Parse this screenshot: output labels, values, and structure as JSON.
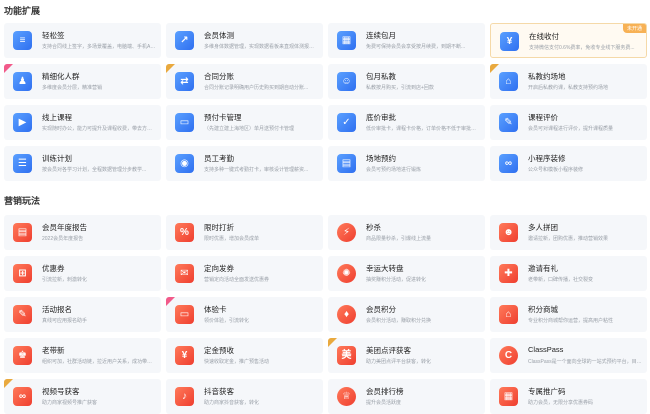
{
  "sections": {
    "features_title": "功能扩展",
    "marketing_title": "营销玩法"
  },
  "features": [
    {
      "title": "轻松签",
      "desc": "支持合同线上签字，多场景覆盖，电脑端、手机APP...",
      "icon": "contract-icon",
      "glyph": "≡",
      "color": "blue"
    },
    {
      "title": "会员体测",
      "desc": "多维身体数据管理，实现数据看板来直观体测报告...",
      "icon": "chart-line-icon",
      "glyph": "↗",
      "color": "blue"
    },
    {
      "title": "连续包月",
      "desc": "免费可保持会员会享受按月续费，到期不断...",
      "icon": "calendar-icon",
      "glyph": "▦",
      "color": "blue"
    },
    {
      "title": "在线收付",
      "desc": "支持微信支付0.6%费率，免收专业线下服务费...",
      "icon": "payment-icon",
      "glyph": "¥",
      "color": "blue",
      "badge": "未开通"
    },
    {
      "title": "精细化人群",
      "desc": "多维度会员分层，精准营销",
      "icon": "user-group-icon",
      "glyph": "♟",
      "color": "blue",
      "corner": "pink"
    },
    {
      "title": "合同分账",
      "desc": "合同分账记录明确用户历史购买到期自动分账...",
      "icon": "split-icon",
      "glyph": "⇄",
      "color": "blue",
      "corner": "gold"
    },
    {
      "title": "包月私教",
      "desc": "私教按月购买，引流到店+回款",
      "icon": "coach-icon",
      "glyph": "☺",
      "color": "blue"
    },
    {
      "title": "私教约场地",
      "desc": "开启后私教约课，私教支持预约场地",
      "icon": "venue-icon",
      "glyph": "⌂",
      "color": "blue",
      "corner": "gold"
    },
    {
      "title": "线上课程",
      "desc": "实现随时办公，能力可提升及课程收费，带去方便工...",
      "icon": "video-icon",
      "glyph": "▶",
      "color": "blue"
    },
    {
      "title": "预付卡管理",
      "desc": "（先建立建上海地区）单月送预付卡管理",
      "icon": "card-icon",
      "glyph": "▭",
      "color": "blue"
    },
    {
      "title": "底价审批",
      "desc": "低价审批卡，课程卡价格，订单价格不低于审批设计...",
      "icon": "approval-icon",
      "glyph": "✓",
      "color": "blue"
    },
    {
      "title": "课程评价",
      "desc": "会员可对课程进行评价，提升课程质量",
      "icon": "comment-icon",
      "glyph": "✎",
      "color": "blue"
    },
    {
      "title": "训练计划",
      "desc": "按会员对各学习计划，全程数据管理分步教学...",
      "icon": "plan-icon",
      "glyph": "☰",
      "color": "blue"
    },
    {
      "title": "员工考勤",
      "desc": "支持多种一键式考勤打卡，审核设计管理薪资...",
      "icon": "location-icon",
      "glyph": "◉",
      "color": "blue"
    },
    {
      "title": "场地预约",
      "desc": "会员可预约场地进行锻炼",
      "icon": "ticket-icon",
      "glyph": "▤",
      "color": "blue"
    },
    {
      "title": "小程序装修",
      "desc": "公众号和模板小程序装修",
      "icon": "miniapp-icon",
      "glyph": "∞",
      "color": "blue"
    }
  ],
  "marketing": [
    {
      "title": "会员年度报告",
      "desc": "2022会员年度报告",
      "icon": "report-icon",
      "glyph": "▤",
      "shape": "sq"
    },
    {
      "title": "限时打折",
      "desc": "限时优惠，增加会员成单",
      "icon": "discount-icon",
      "glyph": "%",
      "shape": "sq"
    },
    {
      "title": "秒杀",
      "desc": "商品限量秒杀，引爆线上流量",
      "icon": "flash-sale-icon",
      "glyph": "⚡",
      "shape": "circle"
    },
    {
      "title": "多人拼团",
      "desc": "邀请拉新，团购优惠，推动营销效果",
      "icon": "group-buy-icon",
      "glyph": "☻",
      "shape": "sq"
    },
    {
      "title": "优惠券",
      "desc": "引流拉新，刺激转化",
      "icon": "coupon-icon",
      "glyph": "⊞",
      "shape": "sq"
    },
    {
      "title": "定向发券",
      "desc": "营销定向活动全面发送优惠券",
      "icon": "targeted-coupon-icon",
      "glyph": "✉",
      "shape": "sq"
    },
    {
      "title": "幸运大转盘",
      "desc": "抽奖赚积分活动，促进转化",
      "icon": "wheel-icon",
      "glyph": "✺",
      "shape": "circle"
    },
    {
      "title": "邀请有礼",
      "desc": "老带新，口碑传播，社交裂变",
      "icon": "invite-icon",
      "glyph": "✚",
      "shape": "sq"
    },
    {
      "title": "活动报名",
      "desc": "真线可应用报名助手",
      "icon": "signup-icon",
      "glyph": "✎",
      "shape": "sq"
    },
    {
      "title": "体验卡",
      "desc": "领价体验，引流转化",
      "icon": "trial-card-icon",
      "glyph": "▭",
      "shape": "sq",
      "corner": "pink"
    },
    {
      "title": "会员积分",
      "desc": "会员积分活动，赚取积分兑换",
      "icon": "points-icon",
      "glyph": "♦",
      "shape": "circle"
    },
    {
      "title": "积分商城",
      "desc": "专业积分商城帮你运营，提高用户粘性",
      "icon": "mall-icon",
      "glyph": "⌂",
      "shape": "sq"
    },
    {
      "title": "老带新",
      "desc": "组织可加，社群活动链，拉近用户关系，成功带来下...",
      "icon": "referral-icon",
      "glyph": "♚",
      "shape": "sq"
    },
    {
      "title": "定金预收",
      "desc": "快速收取定金，推广预售活动",
      "icon": "deposit-icon",
      "glyph": "¥",
      "shape": "sq"
    },
    {
      "title": "美团点评获客",
      "desc": "助力美团点评平台获客，转化",
      "icon": "meituan-icon",
      "glyph": "美",
      "shape": "sq",
      "corner": "gold"
    },
    {
      "title": "ClassPass",
      "desc": "ClassPass是一个面向全球的一站式预约平台，目前已在...",
      "icon": "classpass-icon",
      "glyph": "C",
      "shape": "circle"
    },
    {
      "title": "视频号获客",
      "desc": "助力商家视频号推广获客",
      "icon": "channels-icon",
      "glyph": "∞",
      "shape": "sq",
      "corner": "gold"
    },
    {
      "title": "抖音获客",
      "desc": "助力商家抖音获客，转化",
      "icon": "douyin-icon",
      "glyph": "♪",
      "shape": "sq"
    },
    {
      "title": "会员排行榜",
      "desc": "提升会员活跃度",
      "icon": "trophy-icon",
      "glyph": "♕",
      "shape": "circle"
    },
    {
      "title": "专属推广码",
      "desc": "助力会员，无限分享优惠券码",
      "icon": "qrcode-icon",
      "glyph": "▦",
      "shape": "sq"
    }
  ]
}
